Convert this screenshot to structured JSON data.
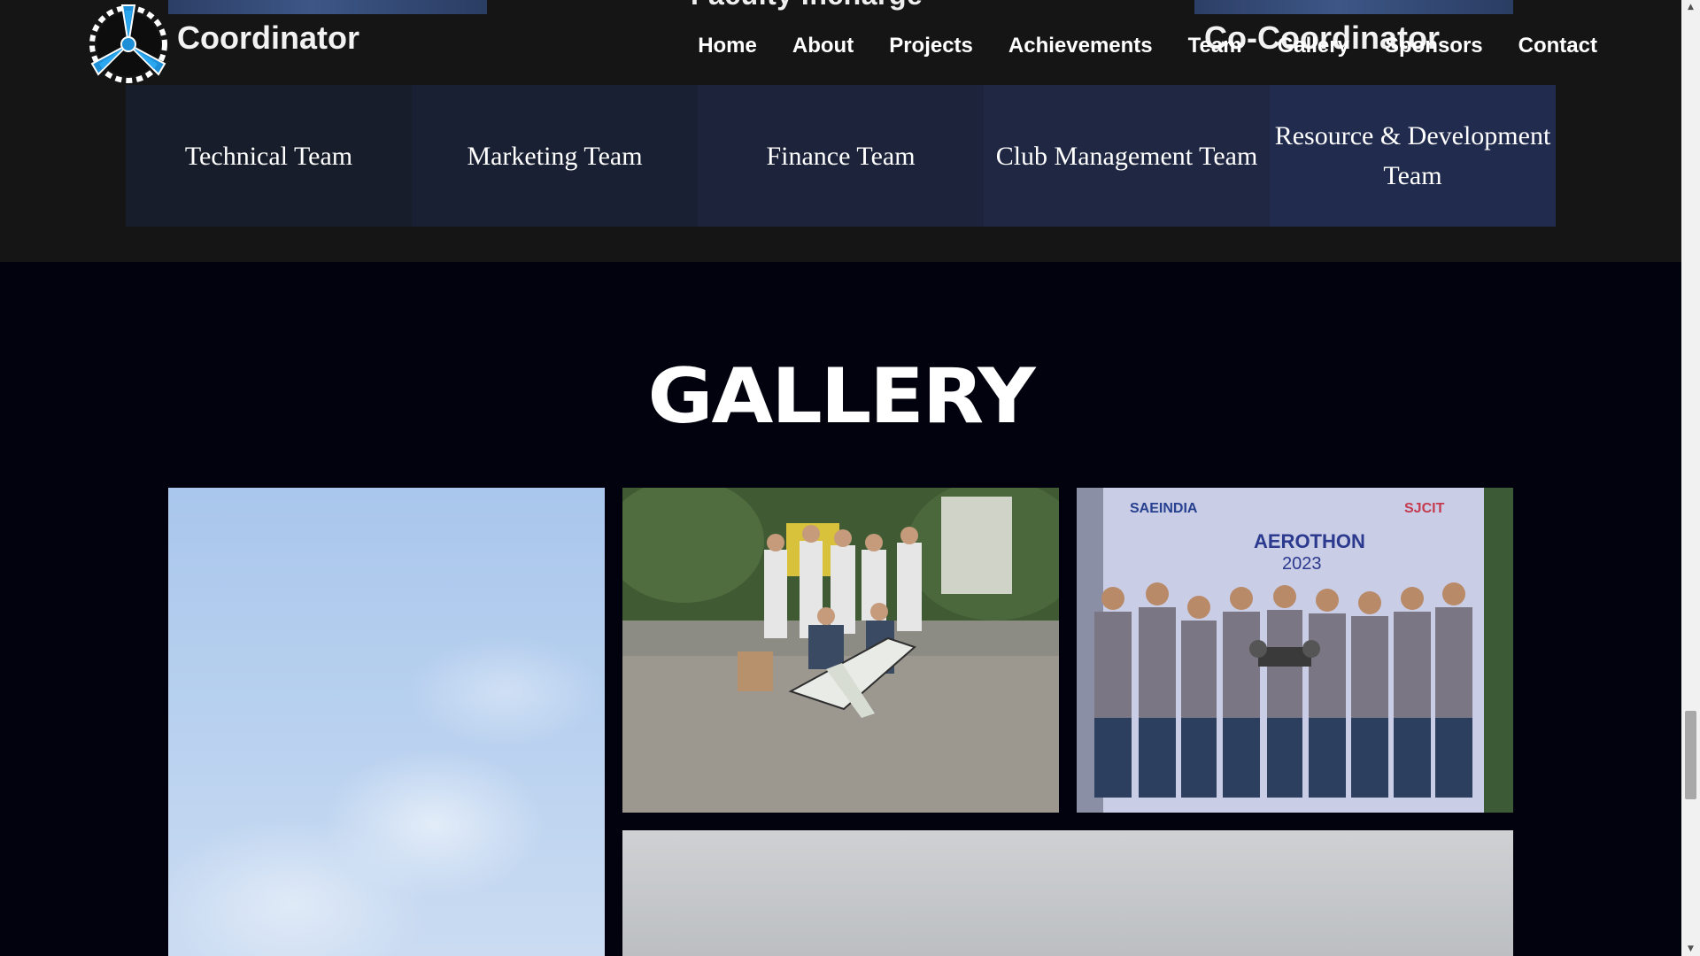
{
  "header": {
    "logo_icon": "gear-propeller-logo",
    "nav": [
      {
        "label": "Home"
      },
      {
        "label": "About"
      },
      {
        "label": "Projects"
      },
      {
        "label": "Achievements"
      },
      {
        "label": "Team"
      },
      {
        "label": "Gallery"
      },
      {
        "label": "Sponsors"
      },
      {
        "label": "Contact"
      }
    ]
  },
  "faculty": {
    "title": "Faculty Incharge",
    "coordinator": "Coordinator",
    "co_coordinator": "Co-Coordinator"
  },
  "teams": [
    {
      "label": "Technical Team"
    },
    {
      "label": "Marketing Team"
    },
    {
      "label": "Finance Team"
    },
    {
      "label": "Club Management Team"
    },
    {
      "label": "Resource & Development Team"
    }
  ],
  "gallery": {
    "title": "GALLERY",
    "photos": [
      {
        "description": "sky-with-clouds"
      },
      {
        "description": "team-with-model-aircraft"
      },
      {
        "description": "team-at-event-banner"
      },
      {
        "description": "overcast-sky"
      }
    ],
    "banner": {
      "event": "AEROTHON",
      "year": "2023",
      "org": "SAEINDIA",
      "college": "SJCIT"
    }
  },
  "colors": {
    "background": "#02020e",
    "top_band": "#151515",
    "team_card_start": "#181d2b",
    "team_card_end": "#212b4d",
    "logo_blue": "#1e8fd6"
  }
}
